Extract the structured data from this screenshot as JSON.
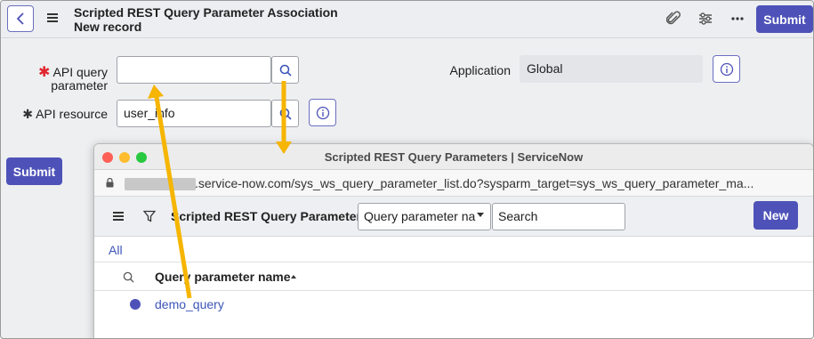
{
  "header": {
    "title_line1": "Scripted REST Query Parameter Association",
    "title_line2": "New record",
    "submit_label": "Submit"
  },
  "form": {
    "api_query_parameter": {
      "label_line1": "API query",
      "label_line2": "parameter",
      "required_mark": "✱",
      "value": ""
    },
    "api_resource": {
      "label": "API resource",
      "required_mark": "✱",
      "value": "user_info"
    },
    "application": {
      "label": "Application",
      "value": "Global"
    },
    "submit_label": "Submit"
  },
  "popup": {
    "window_title": "Scripted REST Query Parameters | ServiceNow",
    "url": ".service-now.com/sys_ws_query_parameter_list.do?sysparm_target=sys_ws_query_parameter_ma...",
    "list_title": "Scripted REST Query Parameters",
    "filter_field": "Query parameter na",
    "search_placeholder": "Search",
    "new_label": "New",
    "breadcrumb_all": "All",
    "column_header": "Query parameter name",
    "rows": [
      {
        "name": "demo_query"
      }
    ]
  },
  "colors": {
    "accent": "#4e52b8",
    "annotation_arrow": "#f5b500",
    "required": "#e0262e",
    "link": "#3c55b8"
  },
  "icons": [
    "back-icon",
    "menu-icon",
    "attachment-icon",
    "settings-icon",
    "more-icon",
    "search-icon",
    "info-icon",
    "lock-icon",
    "filter-icon"
  ]
}
